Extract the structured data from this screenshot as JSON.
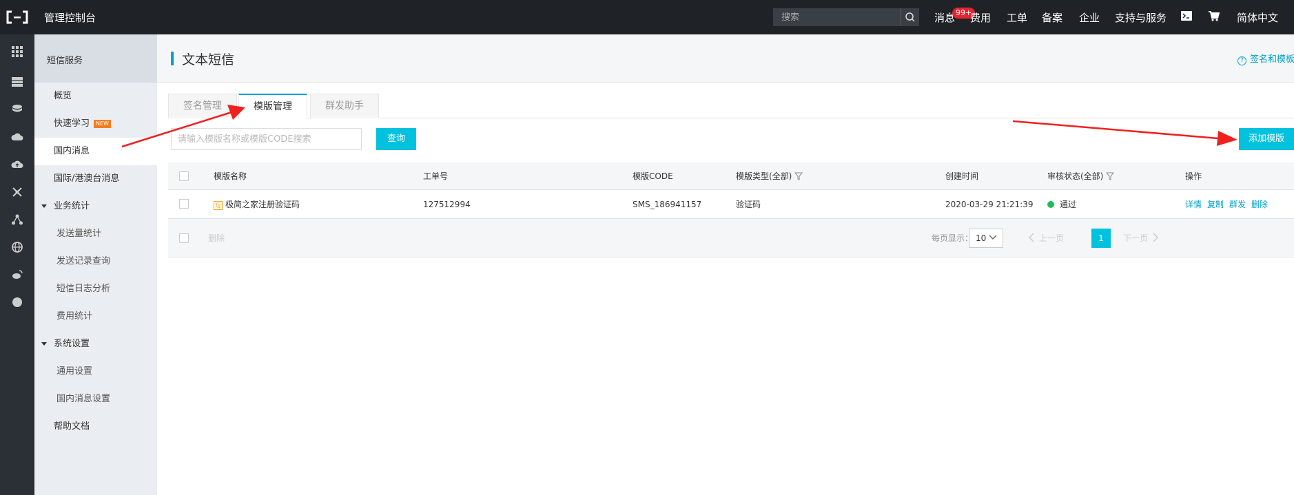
{
  "topbar": {
    "console_title": "管理控制台",
    "search_placeholder": "搜索",
    "nav": {
      "messages": "消息",
      "messages_badge": "99+",
      "fees": "费用",
      "tickets": "工单",
      "filing": "备案",
      "enterprise": "企业",
      "support": "支持与服务",
      "language": "简体中文"
    }
  },
  "sidebar": {
    "header": "短信服务",
    "items": [
      {
        "label": "概览"
      },
      {
        "label": "快速学习",
        "badge": "NEW"
      },
      {
        "label": "国内消息"
      },
      {
        "label": "国际/港澳台消息"
      },
      {
        "label": "业务统计"
      },
      {
        "label": "发送量统计"
      },
      {
        "label": "发送记录查询"
      },
      {
        "label": "短信日志分析"
      },
      {
        "label": "费用统计"
      },
      {
        "label": "系统设置"
      },
      {
        "label": "通用设置"
      },
      {
        "label": "国内消息设置"
      },
      {
        "label": "帮助文档"
      }
    ]
  },
  "main": {
    "title": "文本短信",
    "help_link": "签名和模板",
    "tabs": [
      {
        "label": "签名管理"
      },
      {
        "label": "模版管理"
      },
      {
        "label": "群发助手"
      }
    ],
    "query_placeholder": "请输入模版名称或模版CODE搜索",
    "query_button": "查询",
    "add_button": "添加模版",
    "table": {
      "headers": [
        "模版名称",
        "工单号",
        "模版CODE",
        "模版类型(全部)",
        "创建时间",
        "审核状态(全部)",
        "操作"
      ],
      "rows": [
        {
          "tag": "短",
          "name": "极简之家注册验证码",
          "ticket": "127512994",
          "code": "SMS_186941157",
          "type": "验证码",
          "created": "2020-03-29 21:21:39",
          "status": "通过",
          "ops": [
            "详情",
            "复制",
            "群发",
            "删除"
          ]
        }
      ]
    },
    "footer": {
      "delete": "删除",
      "per_page_label": "每页显示：",
      "per_page": "10",
      "prev": "上一页",
      "current_page": "1",
      "next": "下一页"
    }
  },
  "colors": {
    "accent": "#00c1de",
    "link": "#00a2ca",
    "topbar": "#1f2227",
    "badge": "#e6232e",
    "status_ok": "#1fbc5c",
    "annotation_arrow": "#f0201e"
  }
}
